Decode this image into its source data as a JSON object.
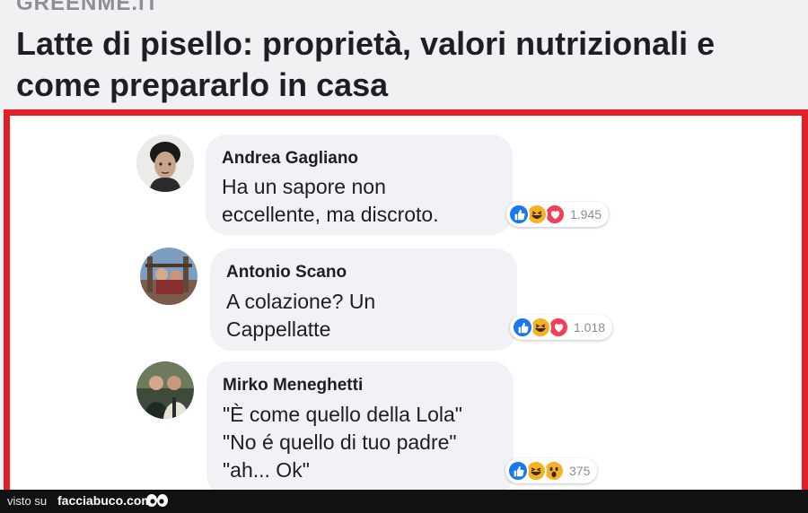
{
  "header": {
    "source": "GREENME.IT",
    "headline_line1": "Latte di pisello: proprietà, valori nutrizionali e",
    "headline_line2": "come prepararlo in casa"
  },
  "comments": [
    {
      "author": "Andrea Gagliano",
      "lines": [
        "Ha un sapore non",
        "eccellente, ma discroto."
      ],
      "reactions": [
        "like-icon",
        "haha-icon",
        "love-icon"
      ],
      "count": "1.945"
    },
    {
      "author": "Antonio Scano",
      "lines": [
        "A colazione? Un",
        "Cappellatte"
      ],
      "reactions": [
        "like-icon",
        "haha-icon",
        "love-icon"
      ],
      "count": "1.018"
    },
    {
      "author": "Mirko Meneghetti",
      "lines": [
        "\"È come quello della Lola\"",
        "\"No é quello di tuo padre\"",
        "\"ah... Ok\""
      ],
      "reactions": [
        "like-icon",
        "haha-icon",
        "wow-icon"
      ],
      "count": "375"
    }
  ],
  "footer": {
    "visto_su": "visto su",
    "site": "facciabuco.com",
    "logo": "eyes-icon"
  },
  "colors": {
    "frame": "#e21e26",
    "like": "#1877f2",
    "haha": "#f7b125",
    "love": "#f33e58"
  }
}
